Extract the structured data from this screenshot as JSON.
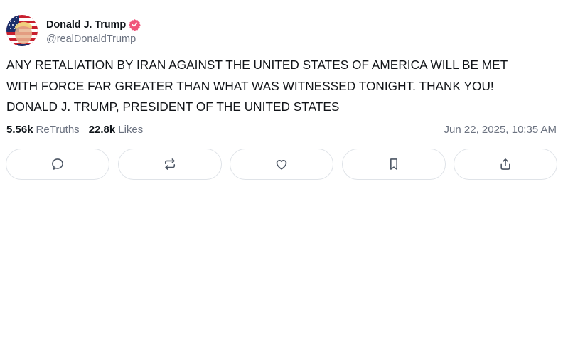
{
  "author": {
    "display_name": "Donald J. Trump",
    "handle": "@realDonaldTrump",
    "verified": true,
    "verified_color": "#f0547a"
  },
  "post": {
    "lines": [
      "ANY RETALIATION BY IRAN AGAINST THE UNITED STATES OF AMERICA WILL BE MET",
      "WITH FORCE FAR GREATER THAN WHAT WAS WITNESSED TONIGHT. THANK YOU!",
      "DONALD J. TRUMP, PRESIDENT OF THE UNITED STATES"
    ]
  },
  "stats": {
    "retruths_count": "5.56k",
    "retruths_label": "ReTruths",
    "likes_count": "22.8k",
    "likes_label": "Likes",
    "timestamp": "Jun 22, 2025, 10:35 AM"
  },
  "actions": [
    {
      "name": "reply",
      "icon": "comment-icon"
    },
    {
      "name": "retruth",
      "icon": "repost-icon"
    },
    {
      "name": "like",
      "icon": "heart-icon"
    },
    {
      "name": "bookmark",
      "icon": "bookmark-icon"
    },
    {
      "name": "share",
      "icon": "share-icon"
    }
  ],
  "colors": {
    "text": "#0f1419",
    "muted": "#6b7280",
    "border": "#dfe3e8",
    "icon": "#4b5563"
  }
}
